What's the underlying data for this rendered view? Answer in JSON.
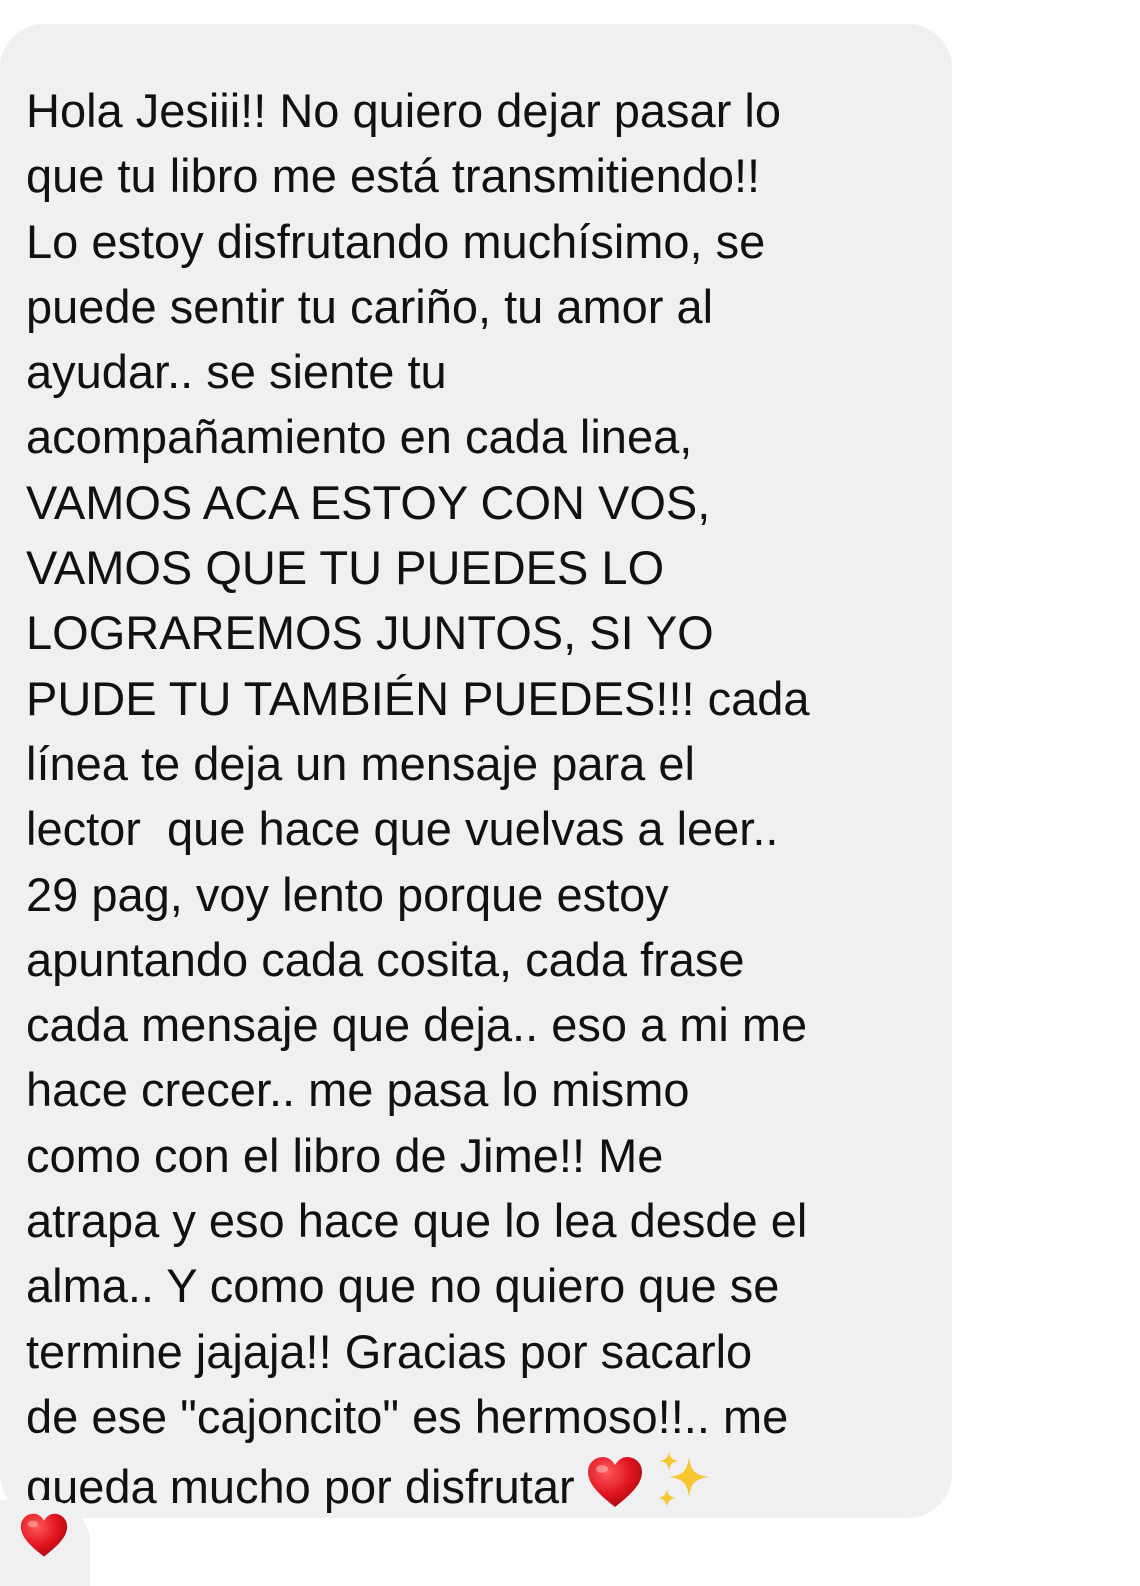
{
  "message": {
    "lines": [
      "Hola Jesiii!! No quiero dejar pasar lo",
      "que tu libro me está transmitiendo!!",
      "Lo estoy disfrutando muchísimo, se",
      "puede sentir tu cariño, tu amor al",
      "ayudar.. se siente tu",
      "acompañamiento en cada linea,",
      "VAMOS ACA ESTOY CON VOS,",
      "VAMOS QUE TU PUEDES LO",
      "LOGRAREMOS JUNTOS, SI YO",
      "PUDE TU TAMBIÉN PUEDES!!! cada",
      "línea te deja un mensaje para el",
      "lector  que hace que vuelvas a leer..",
      "29 pag, voy lento porque estoy",
      "apuntando cada cosita, cada frase",
      "cada mensaje que deja.. eso a mi me",
      "hace crecer.. me pasa lo mismo",
      "como con el libro de Jime!! Me",
      "atrapa y eso hace que lo lea desde el",
      "alma.. Y como que no quiero que se",
      "termine jajaja!! Gracias por sacarlo",
      "de ese \"cajoncito\" es hermoso!!.. me",
      "queda mucho por disfrutar"
    ],
    "trailing_emojis": [
      "heart-emoji",
      "sparkles-emoji"
    ]
  },
  "reaction": {
    "icon": "heart-icon",
    "color": "#e0141e"
  },
  "colors": {
    "bubble": "#f0f0f2",
    "text": "#111111",
    "heart": "#e0141e",
    "sparkles": "#f7c631"
  }
}
